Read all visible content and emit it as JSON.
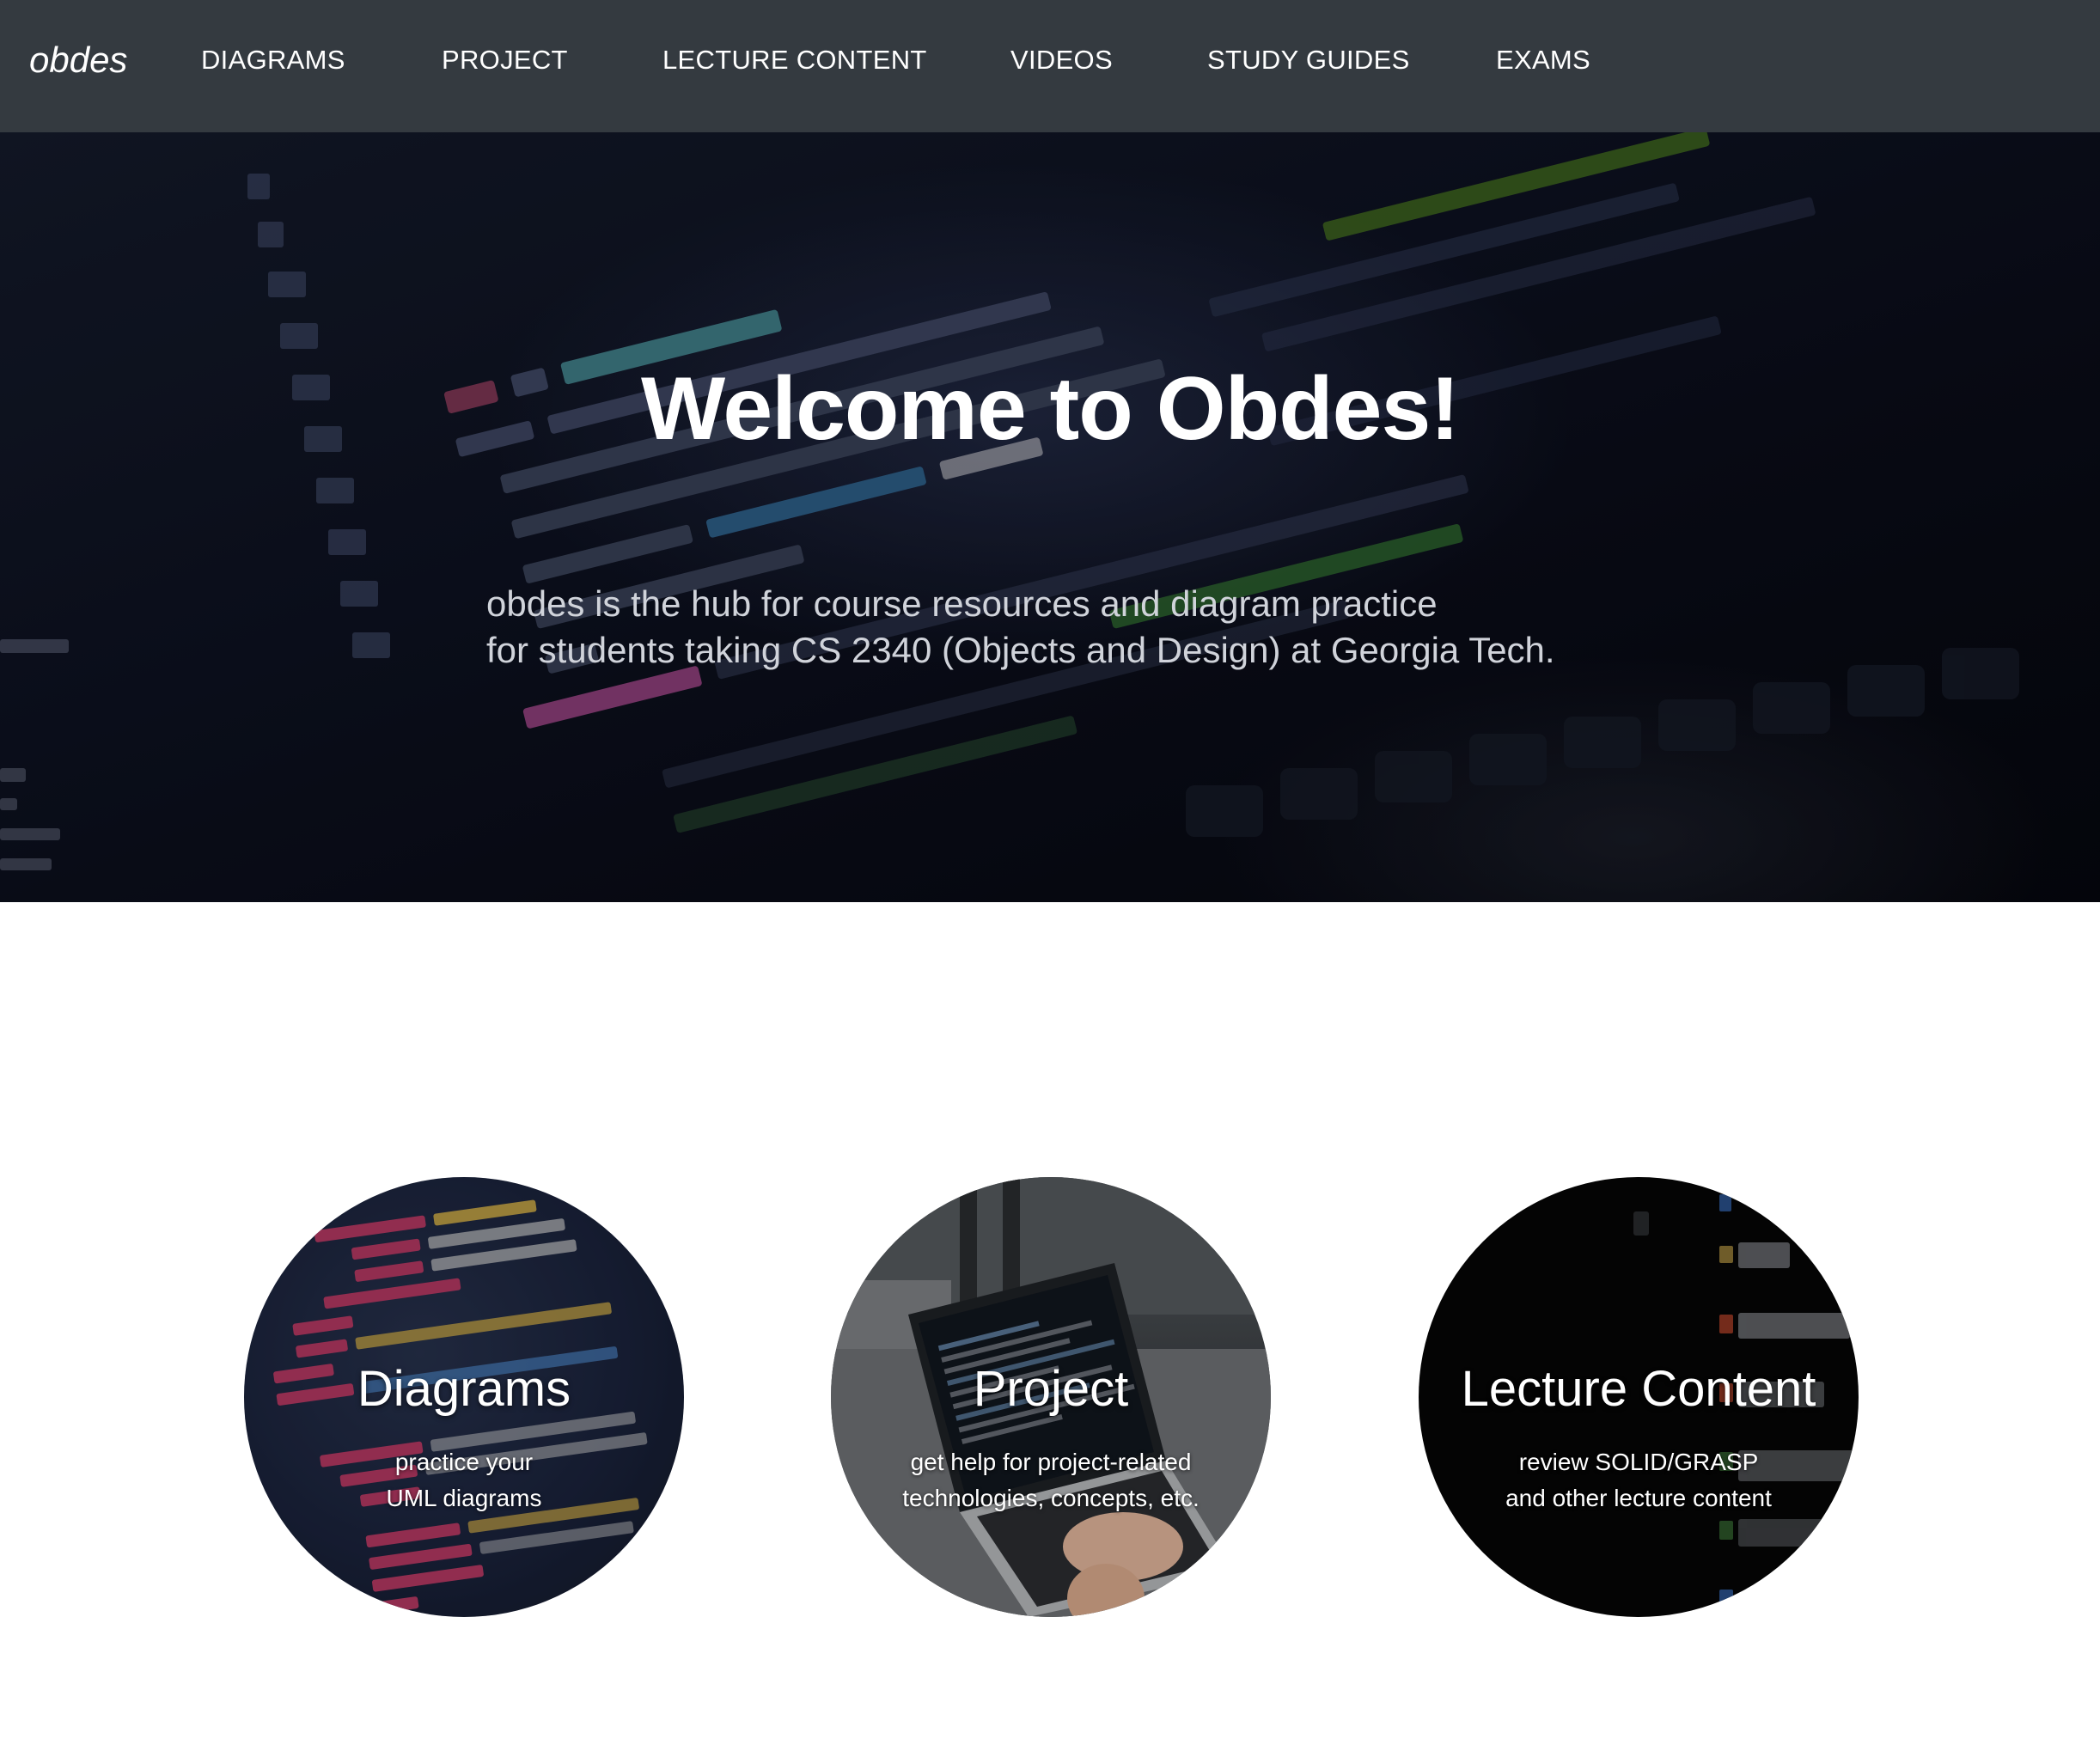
{
  "navbar": {
    "brand": "obdes",
    "links": [
      {
        "label": "DIAGRAMS"
      },
      {
        "label": "PROJECT"
      },
      {
        "label": "LECTURE CONTENT"
      },
      {
        "label": "VIDEOS"
      },
      {
        "label": "STUDY GUIDES"
      },
      {
        "label": "EXAMS"
      }
    ],
    "background_color": "#343a40"
  },
  "hero": {
    "title": "Welcome to Obdes!",
    "subtitle_line1": "obdes is the hub for course resources and diagram practice",
    "subtitle_line2": "for students taking CS 2340 (Objects and Design) at Georgia Tech."
  },
  "cards": [
    {
      "title": "Diagrams",
      "line1": "practice your",
      "line2": "UML diagrams"
    },
    {
      "title": "Project",
      "line1": "get help for project-related",
      "line2": "technologies, concepts, etc."
    },
    {
      "title": "Lecture Content",
      "line1": "review SOLID/GRASP",
      "line2": "and other lecture content"
    }
  ]
}
